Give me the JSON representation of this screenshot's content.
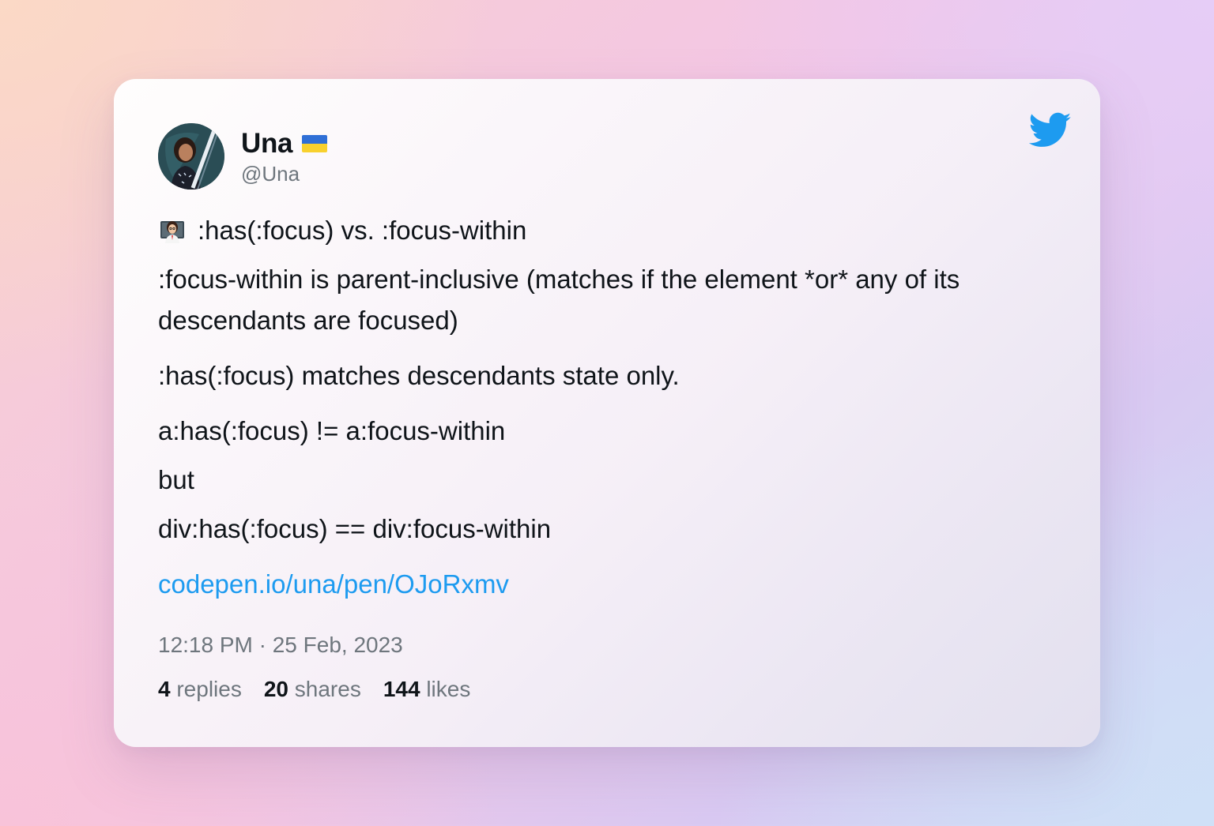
{
  "author": {
    "display_name": "Una",
    "flag_icon": "ukraine-flag-icon",
    "handle": "@Una",
    "avatar_icon": "profile-photo"
  },
  "brand": {
    "icon": "twitter-bird-icon",
    "color": "#1d9bf0"
  },
  "tweet": {
    "emoji_icon": "woman-teacher-emoji-icon",
    "line1": ":has(:focus) vs. :focus-within",
    "line2": ":focus-within is parent-inclusive (matches if the element *or* any of its descendants are focused)",
    "line3": ":has(:focus) matches descendants state only.",
    "line4": "a:has(:focus) != a:focus-within",
    "line5": "but",
    "line6": "div:has(:focus) == div:focus-within",
    "link": "codepen.io/una/pen/OJoRxmv"
  },
  "meta": {
    "timestamp": "12:18 PM · 25 Feb, 2023"
  },
  "stats": {
    "replies_count": "4",
    "replies_label": "replies",
    "shares_count": "20",
    "shares_label": "shares",
    "likes_count": "144",
    "likes_label": "likes"
  }
}
